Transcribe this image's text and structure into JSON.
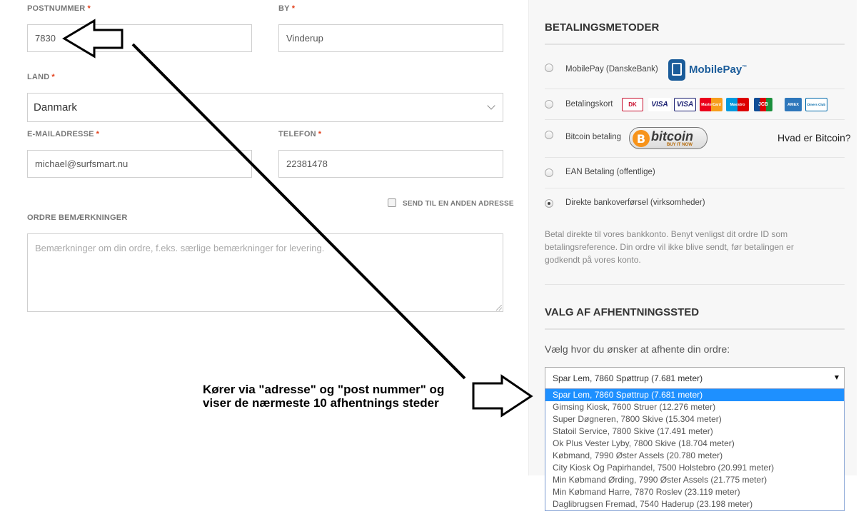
{
  "form": {
    "postcode_label": "POSTNUMMER",
    "postcode_value": "7830",
    "city_label": "BY",
    "city_value": "Vinderup",
    "country_label": "LAND",
    "country_value": "Danmark",
    "email_label": "E-MAILADRESSE",
    "email_value": "michael@surfsmart.nu",
    "phone_label": "TELEFON",
    "phone_value": "22381478",
    "required_mark": "*",
    "ship_other_label": "SEND TIL EN ANDEN ADRESSE",
    "notes_label": "ORDRE BEMÆRKNINGER",
    "notes_placeholder": "Bemærkninger om din ordre, f.eks. særlige bemærkninger for levering."
  },
  "payment": {
    "heading": "BETALINGSMETODER",
    "methods": [
      {
        "label": "MobilePay (DanskeBank)",
        "selected": false
      },
      {
        "label": "Betalingskort",
        "selected": false
      },
      {
        "label": "Bitcoin betaling",
        "selected": false
      },
      {
        "label": "EAN Betaling (offentlige)",
        "selected": false
      },
      {
        "label": "Direkte bankoverførsel (virksomheder)",
        "selected": true
      }
    ],
    "mobilepay_logo": "MobilePay",
    "mobilepay_tm": "™",
    "bitcoin_logo": "bitcoin",
    "bitcoin_symbol": "B",
    "bitcoin_sub": "BUY IT NOW",
    "bitcoin_help": "Hvad er Bitcoin?",
    "cards": [
      "DK",
      "VISA",
      "VISA",
      "MasterCard",
      "Maestro",
      "JCB",
      "AMEX",
      "Diners Club"
    ],
    "description": "Betal direkte til vores bankkonto. Benyt venligst dit ordre ID som betalingsreference. Din ordre vil ikke blive sendt, før betalingen er godkendt på vores konto."
  },
  "pickup": {
    "heading": "VALG AF AFHENTNINGSSTED",
    "prompt": "Vælg hvor du ønsker at afhente din ordre:",
    "selected": "Spar Lem, 7860 Spøttrup (7.681 meter)",
    "options": [
      "Spar Lem, 7860 Spøttrup (7.681 meter)",
      "Gimsing Kiosk, 7600 Struer (12.276 meter)",
      "Super Døgneren, 7800 Skive (15.304 meter)",
      "Statoil Service, 7800 Skive (17.491 meter)",
      "Ok Plus Vester Lyby, 7800 Skive (18.704 meter)",
      "Købmand, 7990 Øster Assels (20.780 meter)",
      "City Kiosk Og Papirhandel, 7500 Holstebro (20.991 meter)",
      "Min Købmand Ørding, 7990 Øster Assels (21.775 meter)",
      "Min Købmand Harre, 7870 Roslev (23.119 meter)",
      "Daglibrugsen Fremad, 7540 Haderup (23.198 meter)"
    ]
  },
  "annotation": {
    "line1": "Kører via \"adresse\" og \"post nummer\" og",
    "line2": "viser de nærmeste 10 afhentnings steder"
  }
}
